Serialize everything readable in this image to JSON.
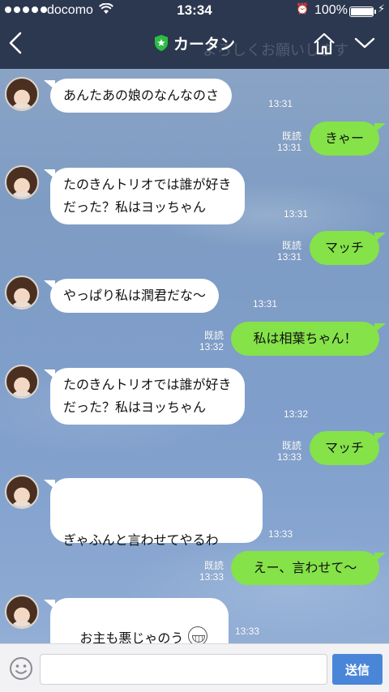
{
  "status_bar": {
    "carrier": "docomo",
    "time": "13:34",
    "battery_percent": "100%",
    "battery_level": 1.0,
    "signal_dots": 5
  },
  "header": {
    "title": "カータン",
    "overlay_text": "よろしくお願いします",
    "icons": [
      "back-chevron-icon",
      "shield-star-icon",
      "home-icon",
      "chevron-down-icon"
    ]
  },
  "messages": [
    {
      "side": "left",
      "text": "あんたあの娘のなんなのさ",
      "time": "13:31"
    },
    {
      "side": "right",
      "text": "きゃー",
      "read": "既読",
      "time": "13:31"
    },
    {
      "side": "left",
      "text": "たのきんトリオでは誰が好き\nだった？私はヨッちゃん",
      "time": "13:31"
    },
    {
      "side": "right",
      "text": "マッチ",
      "read": "既読",
      "time": "13:31"
    },
    {
      "side": "left",
      "text": "やっぱり私は潤君だな〜",
      "time": "13:31"
    },
    {
      "side": "right",
      "text": "私は相葉ちゃん！",
      "read": "既読",
      "time": "13:32"
    },
    {
      "side": "left",
      "text": "たのきんトリオでは誰が好き\nだった？私はヨッちゃん",
      "time": "13:32"
    },
    {
      "side": "right",
      "text": "マッチ",
      "read": "既読",
      "time": "13:33"
    },
    {
      "side": "left",
      "text": "ぎゃふんと言わせてやるわ",
      "sticker": "angry-face-icon",
      "time": "13:33"
    },
    {
      "side": "right",
      "text": "えー、言わせて〜",
      "read": "既読",
      "time": "13:33"
    },
    {
      "side": "left",
      "text": "お主も悪じゃのう",
      "sticker": "grin-face-icon",
      "time": "13:33"
    }
  ],
  "input_bar": {
    "placeholder": "",
    "send_label": "送信"
  },
  "colors": {
    "header_bg": "#2c3850",
    "sent_bubble": "#85e249",
    "received_bubble": "#ffffff",
    "send_button": "#4a86d8"
  }
}
